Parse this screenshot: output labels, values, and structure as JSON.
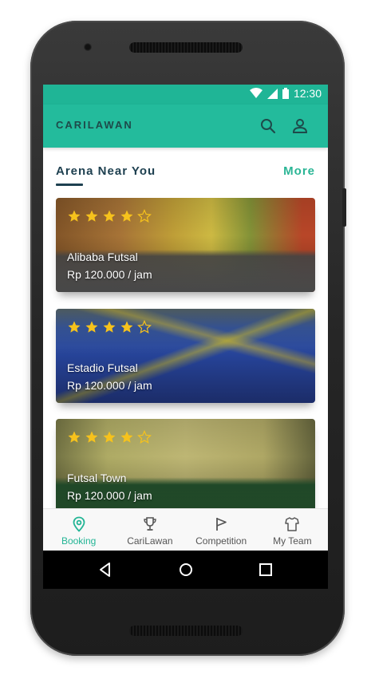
{
  "status_bar": {
    "time": "12:30",
    "icons": [
      "wifi-icon",
      "signal-icon",
      "battery-icon"
    ]
  },
  "app_bar": {
    "title": "CARILAWAN",
    "icons": [
      "search-icon",
      "account-icon"
    ]
  },
  "section": {
    "title": "Arena Near You",
    "more_label": "More"
  },
  "arenas": [
    {
      "name": "Alibaba Futsal",
      "price": "Rp 120.000 / jam",
      "rating": 4,
      "max_rating": 5
    },
    {
      "name": "Estadio Futsal",
      "price": "Rp 120.000 / jam",
      "rating": 4,
      "max_rating": 5
    },
    {
      "name": "Futsal Town",
      "price": "Rp 120.000 / jam",
      "rating": 4,
      "max_rating": 5
    }
  ],
  "bottom_nav": [
    {
      "label": "Booking",
      "icon": "location-pin-icon",
      "active": true
    },
    {
      "label": "CariLawan",
      "icon": "trophy-icon",
      "active": false
    },
    {
      "label": "Competition",
      "icon": "flag-icon",
      "active": false
    },
    {
      "label": "My Team",
      "icon": "jersey-icon",
      "active": false
    }
  ],
  "system_nav": [
    "back-icon",
    "home-icon",
    "recents-icon"
  ],
  "colors": {
    "primary": "#23bb9c",
    "status_bar": "#1fb596",
    "accent_text": "#2ab595",
    "star": "#f6c21c",
    "title_dark": "#1e4050"
  }
}
